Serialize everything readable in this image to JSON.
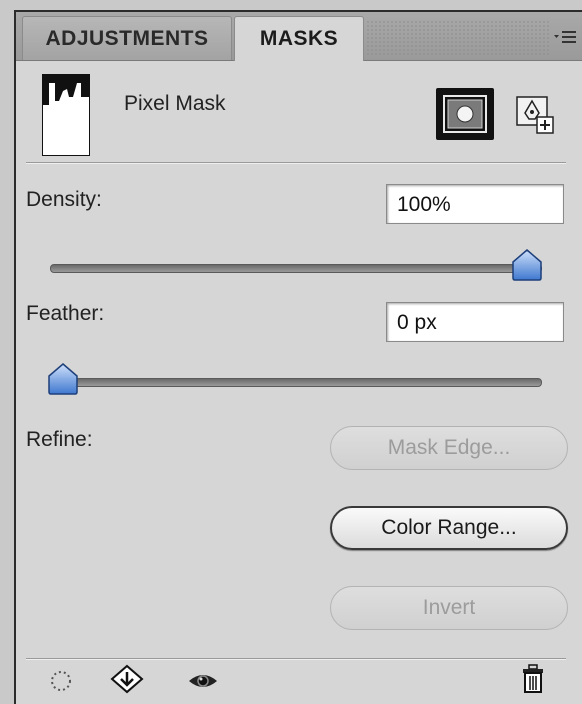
{
  "tabs": [
    {
      "label": "ADJUSTMENTS",
      "active": false
    },
    {
      "label": "MASKS",
      "active": true
    }
  ],
  "mask": {
    "title": "Pixel Mask"
  },
  "density": {
    "label": "Density:",
    "value": "100%",
    "level": 1.0
  },
  "feather": {
    "label": "Feather:",
    "value": "0 px",
    "level": 0.0
  },
  "refine": {
    "label": "Refine:",
    "mask_edge_label": "Mask Edge...",
    "color_range_label": "Color Range...",
    "invert_label": "Invert"
  },
  "footer_icons": [
    "load-selection-icon",
    "apply-mask-icon",
    "visibility-eye-icon",
    "trash-icon"
  ],
  "colors": {
    "panel_bg": "#d6d6d6",
    "tabbar_bg": "#a3a3a3",
    "slider_thumb": "#5c8fd6"
  }
}
